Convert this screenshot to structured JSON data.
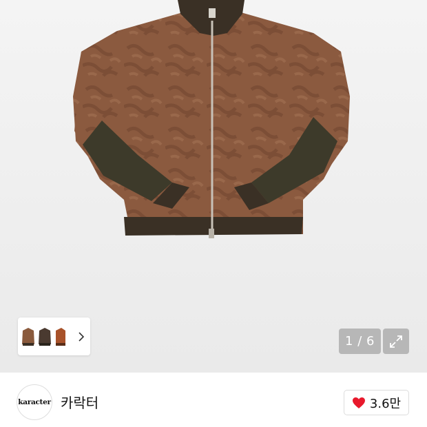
{
  "gallery": {
    "image_alt": "brown leather bomber jacket",
    "page_counter": "1 / 6",
    "thumbnails": [
      {
        "name": "thumbnail-brown-jacket",
        "color": "#8a5a3c"
      },
      {
        "name": "thumbnail-dark-jacket",
        "color": "#4a3a30"
      },
      {
        "name": "thumbnail-rust-jacket",
        "color": "#a8522a"
      }
    ]
  },
  "seller": {
    "avatar_text": "karacter",
    "name": "카락터"
  },
  "like": {
    "count": "3.6만",
    "color": "#e8192c"
  },
  "colors": {
    "jacket_body": "#8b5a3f",
    "rib_knit": "#3d3a2a"
  }
}
